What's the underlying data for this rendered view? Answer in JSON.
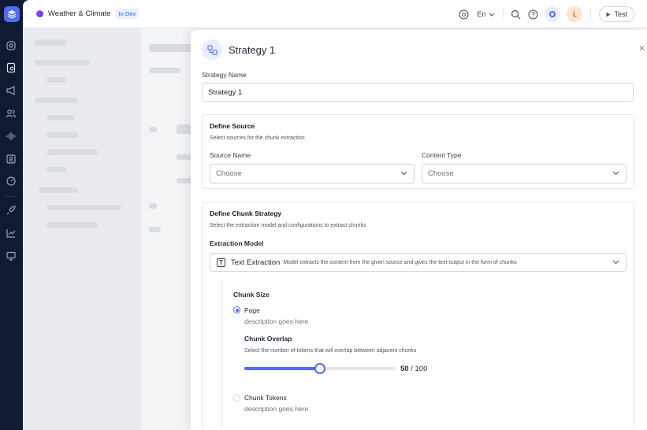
{
  "header": {
    "app_title": "Weather & Climate",
    "env_badge": "In Dev",
    "language": "En",
    "avatar_initial": "L",
    "test_label": "Test"
  },
  "modal": {
    "title": "Strategy 1",
    "strategy_name_label": "Strategy Name",
    "strategy_name_value": "Strategy 1",
    "close_symbol": "×",
    "define_source": {
      "title": "Define Source",
      "subtitle": "Select sources for the chunk extraction",
      "source_name_label": "Source Name",
      "source_name_placeholder": "Choose",
      "content_type_label": "Content Type",
      "content_type_placeholder": "Choose"
    },
    "define_chunk": {
      "title": "Define Chunk Strategy",
      "subtitle": "Select the extraction model and configurations to extract chunks",
      "extraction_model_label": "Extraction Model",
      "extraction_model_name": "Text Extraction",
      "extraction_model_desc": "Model extracts the content from the given source and gives the text output in the form of chunks",
      "chunk_size_label": "Chunk Size",
      "options": [
        {
          "label": "Page",
          "description": "description goes here",
          "selected": true
        },
        {
          "label": "Chunk Tokens",
          "description": "description goes here",
          "selected": false
        }
      ],
      "chunk_overlap_label": "Chunk Overlap",
      "chunk_overlap_desc": "Select the number of tokens that will overlap between adjacent chunks",
      "overlap_value": "50",
      "overlap_max": "/ 100",
      "overlap_fraction": 0.5
    }
  },
  "colors": {
    "accent": "#4f6bf5",
    "rail_bg": "#111a33"
  }
}
